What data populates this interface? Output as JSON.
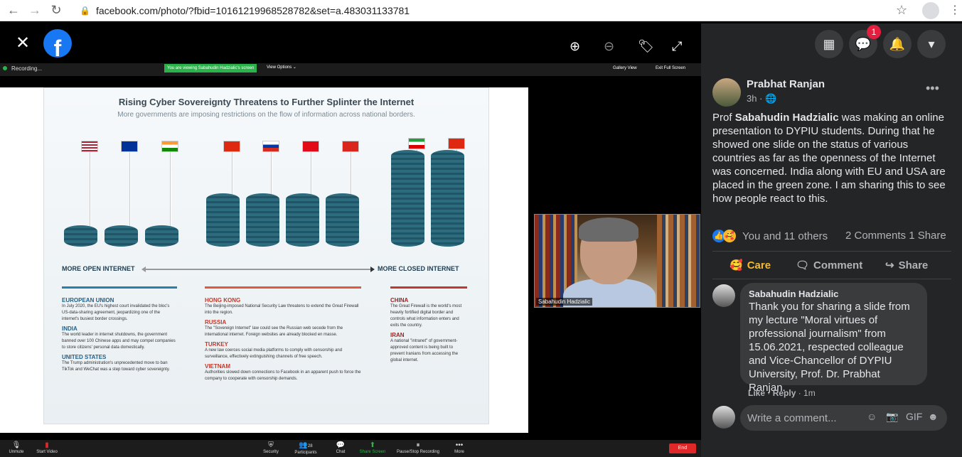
{
  "browser": {
    "url": "facebook.com/photo/?fbid=10161219968528782&set=a.483031133781",
    "back_icon": "arrow-left-icon",
    "forward_icon": "arrow-right-icon",
    "reload_icon": "reload-icon"
  },
  "zoom": {
    "recording": "Recording...",
    "viewing_banner": "You are viewing Sabahudin Hadzialic's screen",
    "view_options": "View Options ⌄",
    "gallery_view": "Gallery View",
    "exit_full_screen": "Exit Full Screen",
    "participant_label": "Sabahudin Hadzialic",
    "participants_count": "28",
    "bottom": [
      "Unmute",
      "Start Video",
      "Security",
      "Participants",
      "Chat",
      "Share Screen",
      "Pause/Stop Recording",
      "More"
    ],
    "end": "End"
  },
  "slide": {
    "title": "Rising Cyber Sovereignty Threatens to Further Splinter the Internet",
    "subtitle": "More governments are imposing restrictions on the flow of information across national borders.",
    "open_label": "MORE OPEN INTERNET",
    "closed_label": "MORE CLOSED INTERNET",
    "col1": [
      {
        "h": "EUROPEAN UNION",
        "t": "In July 2020, the EU's highest court invalidated the bloc's US-data-sharing agreement, jeopardizing one of the internet's busiest border crossings."
      },
      {
        "h": "INDIA",
        "t": "The world leader in internet shutdowns, the government banned over 100 Chinese apps and may compel companies to store citizens' personal data domestically."
      },
      {
        "h": "UNITED STATES",
        "t": "The Trump administration's unprecedented move to ban TikTok and WeChat was a step toward cyber sovereignty."
      }
    ],
    "col2": [
      {
        "h": "HONG KONG",
        "t": "The Beijing-imposed National Security Law threatens to extend the Great Firewall into the region."
      },
      {
        "h": "RUSSIA",
        "t": "The \"Sovereign Internet\" law could see the Russian web secede from the international internet. Foreign websites are already blocked en masse."
      },
      {
        "h": "TURKEY",
        "t": "A new law coerces social media platforms to comply with censorship and surveillance, effectively extinguishing channels of free speech."
      },
      {
        "h": "VIETNAM",
        "t": "Authorities slowed down connections to Facebook in an apparent push to force the company to cooperate with censorship demands."
      }
    ],
    "col3": [
      {
        "h": "CHINA",
        "t": "The Great Firewall is the world's most heavily fortified digital border and controls what information enters and exits the country."
      },
      {
        "h": "IRAN",
        "t": "A national \"intranet\" of government-approved content is being built to prevent Iranians from accessing the global internet."
      }
    ]
  },
  "post": {
    "author": "Prabhat Ranjan",
    "time": "3h · 🌐",
    "text_prefix": "Prof ",
    "text_name": "Sabahudin Hadzialic",
    "text_rest": " was making an online presentation to DYPIU students. During that he showed one slide on the status of various countries as far as the openness of the Internet was concerned. India along with EU and USA are placed in the green zone. I am sharing this to see how people react to this.",
    "reactions": "You and 11 others",
    "counts": "2 Comments  1 Share",
    "actions": {
      "care": "Care",
      "comment": "Comment",
      "share": "Share"
    },
    "notification_count": "1"
  },
  "comment": {
    "name": "Sabahudin Hadzialic",
    "text": "Thank you for sharing a slide from my lecture \"Moral virtues of professional journalism\" from 15.06.2021, respected colleague and Vice-Chancellor of DYPIU University, Prof. Dr. Prabhat Ranjan.",
    "like": "Like",
    "reply": "Reply",
    "time": "1m"
  },
  "write": {
    "placeholder": "Write a comment..."
  },
  "colors": {
    "fb_blue": "#1877f2",
    "panel_bg": "#242526",
    "bubble_bg": "#3a3b3c",
    "zoom_green": "#2bb34b",
    "end_red": "#e02828"
  }
}
